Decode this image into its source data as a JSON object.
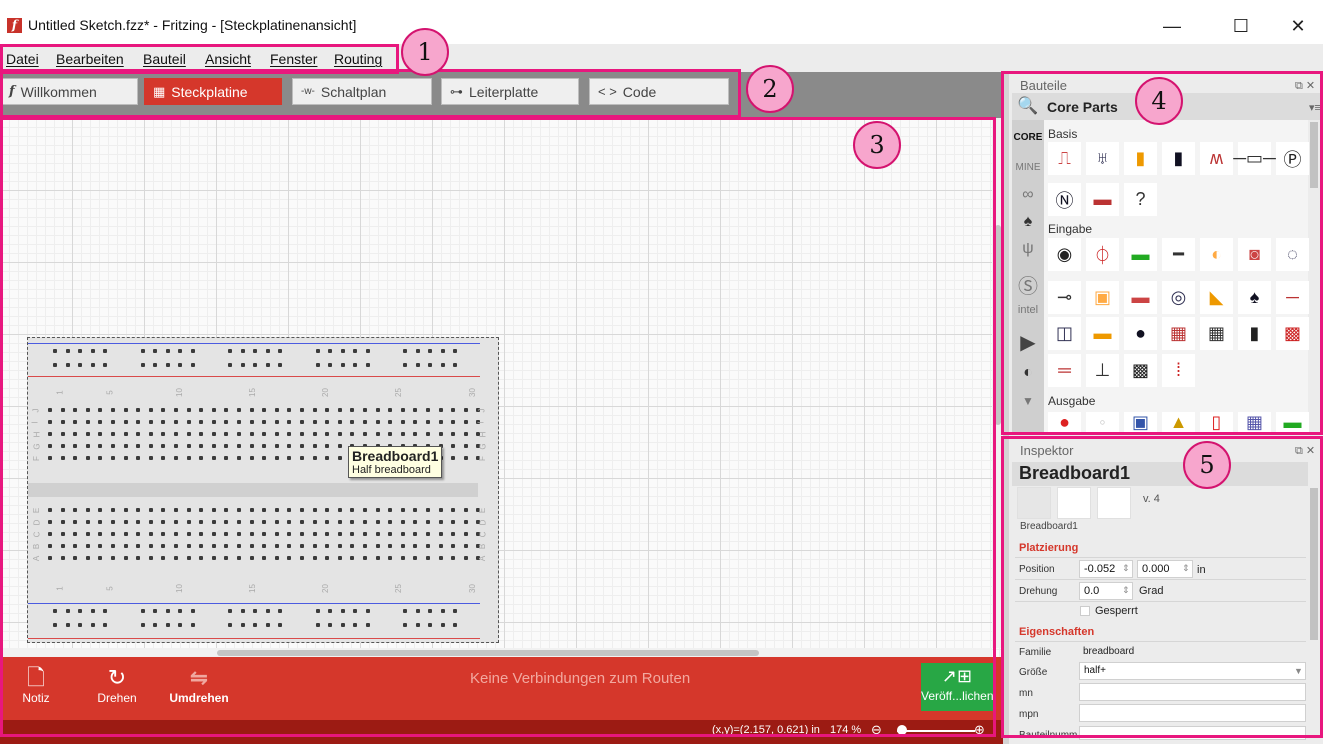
{
  "window": {
    "title": "Untitled Sketch.fzz* - Fritzing - [Steckplatinenansicht]",
    "logo": "f",
    "minimize": "—",
    "maximize": "☐",
    "close": "✕"
  },
  "menu": [
    "Datei",
    "Bearbeiten",
    "Bauteil",
    "Ansicht",
    "Fenster",
    "Routing"
  ],
  "tabs": [
    {
      "label": "Willkommen",
      "icon": "f"
    },
    {
      "label": "Steckplatine",
      "icon": "▦",
      "active": true
    },
    {
      "label": "Schaltplan",
      "icon": "-w-"
    },
    {
      "label": "Leiterplatte",
      "icon": "⊶"
    },
    {
      "label": "Code",
      "icon": "< >"
    }
  ],
  "breadboard": {
    "tooltip_title": "Breadboard1",
    "tooltip_subtitle": "Half breadboard",
    "col_numbers": [
      "1",
      "5",
      "10",
      "15",
      "20",
      "25",
      "30"
    ],
    "row_letters_top": [
      "J",
      "I",
      "H",
      "G",
      "F"
    ],
    "row_letters_bottom": [
      "E",
      "D",
      "C",
      "B",
      "A"
    ]
  },
  "toolbar": {
    "note": "Notiz",
    "rotate": "Drehen",
    "flip": "Umdrehen",
    "routing_status": "Keine Verbindungen zum Routen",
    "publish": "Veröff...lichen"
  },
  "status": {
    "coords": "(x,y)=(2.157, 0.621) in",
    "zoom": "174 %",
    "zoom_fraction": 0.03
  },
  "parts": {
    "panel_title": "Bauteile",
    "bin_title": "Core Parts",
    "bins": [
      "CORE",
      "MINE"
    ],
    "categories": [
      "Basis",
      "Eingabe",
      "Ausgabe"
    ]
  },
  "inspector": {
    "panel_title": "Inspektor",
    "title": "Breadboard1",
    "version": "v. 4",
    "name": "Breadboard1",
    "placement_header": "Platzierung",
    "position_label": "Position",
    "position_x": "-0.052",
    "position_y": "0.000",
    "position_unit": "in",
    "rotation_label": "Drehung",
    "rotation_value": "0.0",
    "rotation_unit": "Grad",
    "locked_label": "Gesperrt",
    "properties_header": "Eigenschaften",
    "family_label": "Familie",
    "family_value": "breadboard",
    "size_label": "Größe",
    "size_value": "half+",
    "mn_label": "mn",
    "mpn_label": "mpn",
    "partnumber_label": "Bauteilnumm"
  },
  "annotations": [
    "1",
    "2",
    "3",
    "4",
    "5"
  ],
  "colors": {
    "accent": "#d5372b",
    "annotation": "#e8177e",
    "publish": "#28a745"
  }
}
